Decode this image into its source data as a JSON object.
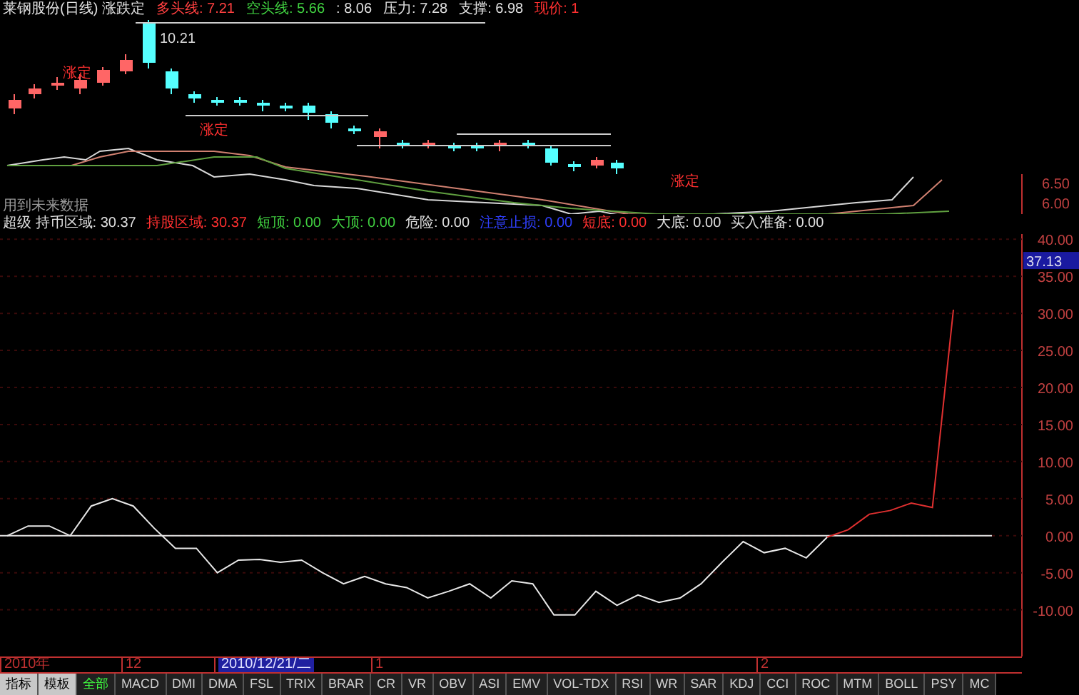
{
  "header": [
    {
      "text": "莱钢股份(日线) 涨跌定",
      "color": "#e0e0e0"
    },
    {
      "text": "多头线: 7.21",
      "color": "#ff4040"
    },
    {
      "text": "空头线: 5.66",
      "color": "#40d040"
    },
    {
      "text": ": 8.06",
      "color": "#e0e0e0"
    },
    {
      "text": "压力: 7.28",
      "color": "#e0e0e0"
    },
    {
      "text": "支撑: 6.98",
      "color": "#e0e0e0"
    },
    {
      "text": "现价: 1",
      "color": "#ff3030"
    }
  ],
  "price_chart": {
    "high_label": "10.21",
    "signal_labels": [
      "涨定",
      "涨定",
      "涨定"
    ],
    "axis_labels": [
      "6.50",
      "6.00"
    ],
    "note": "用到未来数据"
  },
  "indicator_header": [
    {
      "text": "超级  持币区域: 30.37",
      "color": "#e0e0e0"
    },
    {
      "text": "持股区域: 30.37",
      "color": "#ff3030"
    },
    {
      "text": "短顶: 0.00",
      "color": "#40d040"
    },
    {
      "text": "大顶: 0.00",
      "color": "#40d040"
    },
    {
      "text": "危险: 0.00",
      "color": "#e0e0e0"
    },
    {
      "text": "注意止损: 0.00",
      "color": "#3040ff"
    },
    {
      "text": "短底: 0.00",
      "color": "#ff3030"
    },
    {
      "text": "大底: 0.00",
      "color": "#e0e0e0"
    },
    {
      "text": "买入准备: 0.00",
      "color": "#e0e0e0"
    }
  ],
  "indicator_chart": {
    "current_value": "37.13",
    "chart_data": {
      "type": "line",
      "grid": true,
      "ylim": [
        -16.3,
        40.7
      ],
      "yticks": [
        {
          "value": 40,
          "label": "40.00"
        },
        {
          "value": 35,
          "label": "35.00"
        },
        {
          "value": 30,
          "label": "30.00"
        },
        {
          "value": 25,
          "label": "25.00"
        },
        {
          "value": 20,
          "label": "20.00"
        },
        {
          "value": 15,
          "label": "15.00"
        },
        {
          "value": 10,
          "label": "10.00"
        },
        {
          "value": 5,
          "label": "5.00"
        },
        {
          "value": 0,
          "label": "0.00"
        },
        {
          "value": -5,
          "label": "-5.00"
        },
        {
          "value": -10,
          "label": "-10.00"
        }
      ],
      "series": [
        {
          "color": "#e8e8e8",
          "values": [
            0,
            1.3,
            1.3,
            0,
            4,
            5,
            4,
            1,
            -1.7,
            -1.7,
            -5,
            -3.3,
            -3.2,
            -3.6,
            -3.3,
            -5,
            -6.5,
            -5.5,
            -6.5,
            -7,
            -8.4,
            -7.5,
            -6.5,
            -8.4,
            -6.1,
            -6.5,
            -10.7,
            -10.7,
            -7.5,
            -9.4,
            -8,
            -9,
            -8.4,
            -6.5,
            -3.6,
            -0.8,
            -2.3,
            -1.7,
            -3,
            -0.2,
            null,
            null,
            null,
            null,
            null,
            null
          ]
        },
        {
          "color": "#e03030",
          "values": [
            null,
            null,
            null,
            null,
            null,
            null,
            null,
            null,
            null,
            null,
            null,
            null,
            null,
            null,
            null,
            null,
            null,
            null,
            null,
            null,
            null,
            null,
            null,
            null,
            null,
            null,
            null,
            null,
            null,
            null,
            null,
            null,
            null,
            null,
            null,
            null,
            null,
            null,
            null,
            -0.2,
            0.8,
            2.9,
            3.4,
            4.4,
            3.8,
            30.5
          ]
        }
      ]
    }
  },
  "time_axis": [
    {
      "label": "2010年",
      "selected": false
    },
    {
      "label": "12",
      "selected": false
    },
    {
      "label": "2010/12/21/二",
      "selected": true
    },
    {
      "label": "1",
      "selected": false
    },
    {
      "label": "2",
      "selected": false
    }
  ],
  "tabs": [
    {
      "label": "指标",
      "selected": false,
      "kind": "mode"
    },
    {
      "label": "模板",
      "selected": false,
      "kind": "mode"
    },
    {
      "label": "全部",
      "selected": true,
      "kind": "group"
    },
    {
      "label": "MACD",
      "selected": false,
      "kind": "indicator"
    },
    {
      "label": "DMI",
      "selected": false,
      "kind": "indicator"
    },
    {
      "label": "DMA",
      "selected": false,
      "kind": "indicator"
    },
    {
      "label": "FSL",
      "selected": false,
      "kind": "indicator"
    },
    {
      "label": "TRIX",
      "selected": false,
      "kind": "indicator"
    },
    {
      "label": "BRAR",
      "selected": false,
      "kind": "indicator"
    },
    {
      "label": "CR",
      "selected": false,
      "kind": "indicator"
    },
    {
      "label": "VR",
      "selected": false,
      "kind": "indicator"
    },
    {
      "label": "OBV",
      "selected": false,
      "kind": "indicator"
    },
    {
      "label": "ASI",
      "selected": false,
      "kind": "indicator"
    },
    {
      "label": "EMV",
      "selected": false,
      "kind": "indicator"
    },
    {
      "label": "VOL-TDX",
      "selected": false,
      "kind": "indicator"
    },
    {
      "label": "RSI",
      "selected": false,
      "kind": "indicator"
    },
    {
      "label": "WR",
      "selected": false,
      "kind": "indicator"
    },
    {
      "label": "SAR",
      "selected": false,
      "kind": "indicator"
    },
    {
      "label": "KDJ",
      "selected": false,
      "kind": "indicator"
    },
    {
      "label": "CCI",
      "selected": false,
      "kind": "indicator"
    },
    {
      "label": "ROC",
      "selected": false,
      "kind": "indicator"
    },
    {
      "label": "MTM",
      "selected": false,
      "kind": "indicator"
    },
    {
      "label": "BOLL",
      "selected": false,
      "kind": "indicator"
    },
    {
      "label": "PSY",
      "selected": false,
      "kind": "indicator"
    },
    {
      "label": "MC",
      "selected": false,
      "kind": "indicator"
    }
  ]
}
